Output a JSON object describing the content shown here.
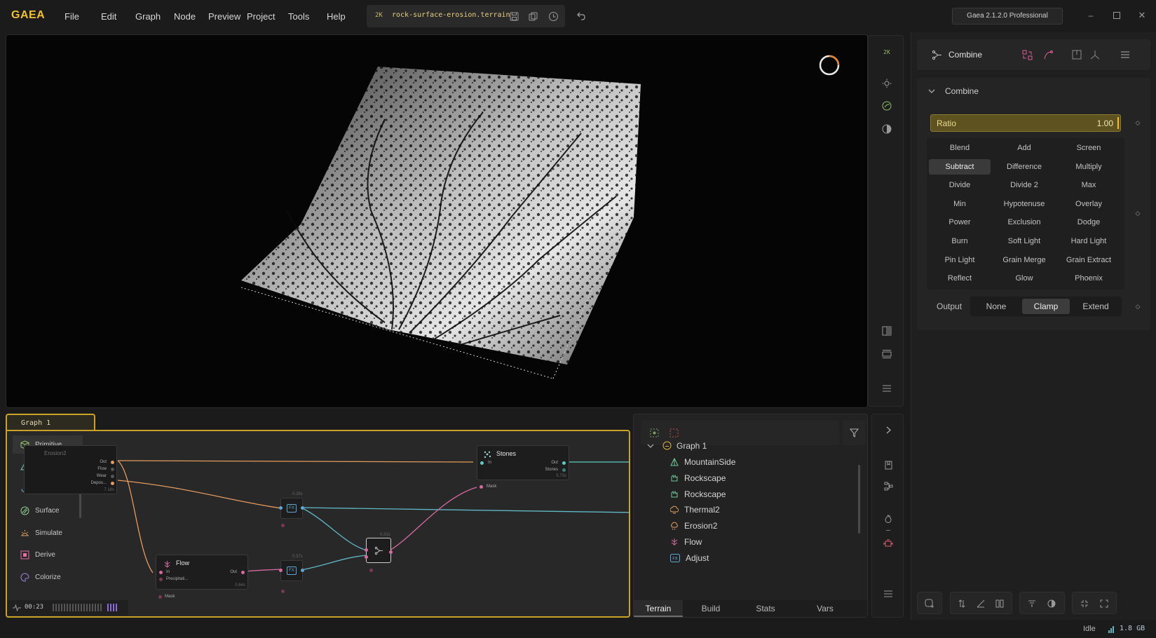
{
  "app": {
    "logo": "GAEA",
    "version": "Gaea 2.1.2.0 Professional"
  },
  "menu": [
    "File",
    "Edit",
    "Graph",
    "Node",
    "Preview",
    "Project",
    "Tools",
    "Help"
  ],
  "file": {
    "resolution": "2K",
    "name": "rock-surface-erosion.terrain"
  },
  "viewport": {
    "resolution_badge": "2K"
  },
  "properties": {
    "node_title": "Combine",
    "section_title": "Combine",
    "ratio": {
      "label": "Ratio",
      "value": "1.00"
    },
    "modes": [
      "Blend",
      "Add",
      "Screen",
      "Subtract",
      "Difference",
      "Multiply",
      "Divide",
      "Divide 2",
      "Max",
      "Min",
      "Hypotenuse",
      "Overlay",
      "Power",
      "Exclusion",
      "Dodge",
      "Burn",
      "Soft Light",
      "Hard Light",
      "Pin Light",
      "Grain Merge",
      "Grain Extract",
      "Reflect",
      "Glow",
      "Phoenix"
    ],
    "selected_mode": "Subtract",
    "output": {
      "label": "Output",
      "options": [
        "None",
        "Clamp",
        "Extend"
      ],
      "selected": "Clamp"
    }
  },
  "graph": {
    "tab": "Graph 1",
    "palette": [
      {
        "label": "Primitive",
        "icon": "cube-icon",
        "color": "#8fbf6a"
      },
      {
        "label": "Terrain",
        "icon": "mountain-icon",
        "color": "#78c6b8"
      },
      {
        "label": "Modify",
        "icon": "modify-icon",
        "color": "#78b6d6"
      },
      {
        "label": "Surface",
        "icon": "surface-icon",
        "color": "#8fcf8f"
      },
      {
        "label": "Simulate",
        "icon": "simulate-icon",
        "color": "#e0a060"
      },
      {
        "label": "Derive",
        "icon": "derive-icon",
        "color": "#e070a0"
      },
      {
        "label": "Colorize",
        "icon": "colorize-icon",
        "color": "#a080e0"
      }
    ],
    "nodes": {
      "erosion2": {
        "title": "Erosion2",
        "ports": [
          "Out",
          "Flow",
          "Wear",
          "Depos..."
        ],
        "time": "7.18s"
      },
      "stones": {
        "title": "Stones",
        "in": "In",
        "outs": [
          "Out",
          "Stones"
        ],
        "mask": "Mask",
        "time": "5.73s"
      },
      "flow": {
        "title": "Flow",
        "ins": [
          "In",
          "Precipitati..."
        ],
        "out": "Out",
        "mask": "Mask",
        "time": "0.64s"
      },
      "fx1_time": "0.28s",
      "fx2_time": "0.37s",
      "combine_time": "0.31s"
    },
    "timer": "00:23"
  },
  "tree": {
    "root": "Graph 1",
    "items": [
      {
        "label": "MountainSide",
        "icon": "mountain-icon",
        "color": "#6fc79a"
      },
      {
        "label": "Rockscape",
        "icon": "rock-icon",
        "color": "#6fc79a"
      },
      {
        "label": "Rockscape",
        "icon": "rock-icon",
        "color": "#6fc79a"
      },
      {
        "label": "Thermal2",
        "icon": "thermal-icon",
        "color": "#e3a060"
      },
      {
        "label": "Erosion2",
        "icon": "erosion-icon",
        "color": "#e3a060"
      },
      {
        "label": "Flow",
        "icon": "flow-icon",
        "color": "#d86aa0"
      },
      {
        "label": "Adjust",
        "icon": "fx-icon",
        "color": "#5fa7d0"
      }
    ],
    "tabs": [
      "Terrain",
      "Build",
      "Stats",
      "Vars"
    ],
    "selected_tab": "Terrain"
  },
  "status": {
    "state": "Idle",
    "memory": "1.8 GB"
  }
}
